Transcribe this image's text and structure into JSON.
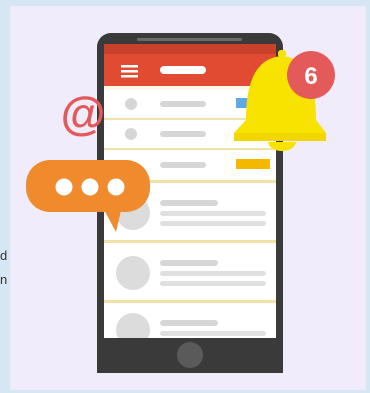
{
  "side_text": [
    "d",
    "n"
  ],
  "notification": {
    "count": "6",
    "bell_color": "#f7e200",
    "badge_color": "#e45a5a"
  },
  "chat_bubble": {
    "color": "#ef8b2c",
    "dots": 3
  },
  "at_symbol": {
    "glyph": "@",
    "color": "#e45a5a"
  },
  "phone": {
    "body_color": "#3a3a3a",
    "header_color": "#e04b31",
    "screen_color": "#fbf7ea"
  }
}
